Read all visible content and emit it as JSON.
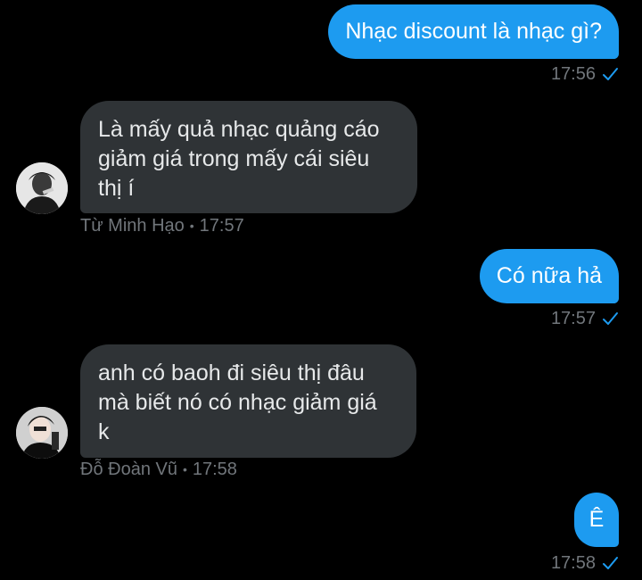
{
  "messages": [
    {
      "side": "out",
      "text": "Nhạc discount là nhạc gì?",
      "time": "17:56"
    },
    {
      "side": "in",
      "text": "Là mấy quả nhạc quảng cáo\ngiảm giá trong mấy cái siêu\nthị í",
      "sender": "Từ Minh Hạo",
      "time": "17:57",
      "avatar": "avatar-photo"
    },
    {
      "side": "out",
      "text": "Có nữa hả",
      "time": "17:57"
    },
    {
      "side": "in",
      "text": "anh có baoh đi siêu thị đâu\nmà biết nó có nhạc giảm giá\nk",
      "sender": "Đỗ Đoàn Vũ",
      "time": "17:58",
      "avatar": "avatar-photo"
    },
    {
      "side": "out",
      "text": "Ê",
      "time": "17:58"
    }
  ],
  "separator": "•",
  "colors": {
    "outgoing_bubble": "#1d9bf0",
    "incoming_bubble": "#2f3336",
    "meta_text": "#71767b",
    "read_check": "#1d9bf0"
  },
  "icons": {
    "read_receipt": "checkmark-icon"
  }
}
